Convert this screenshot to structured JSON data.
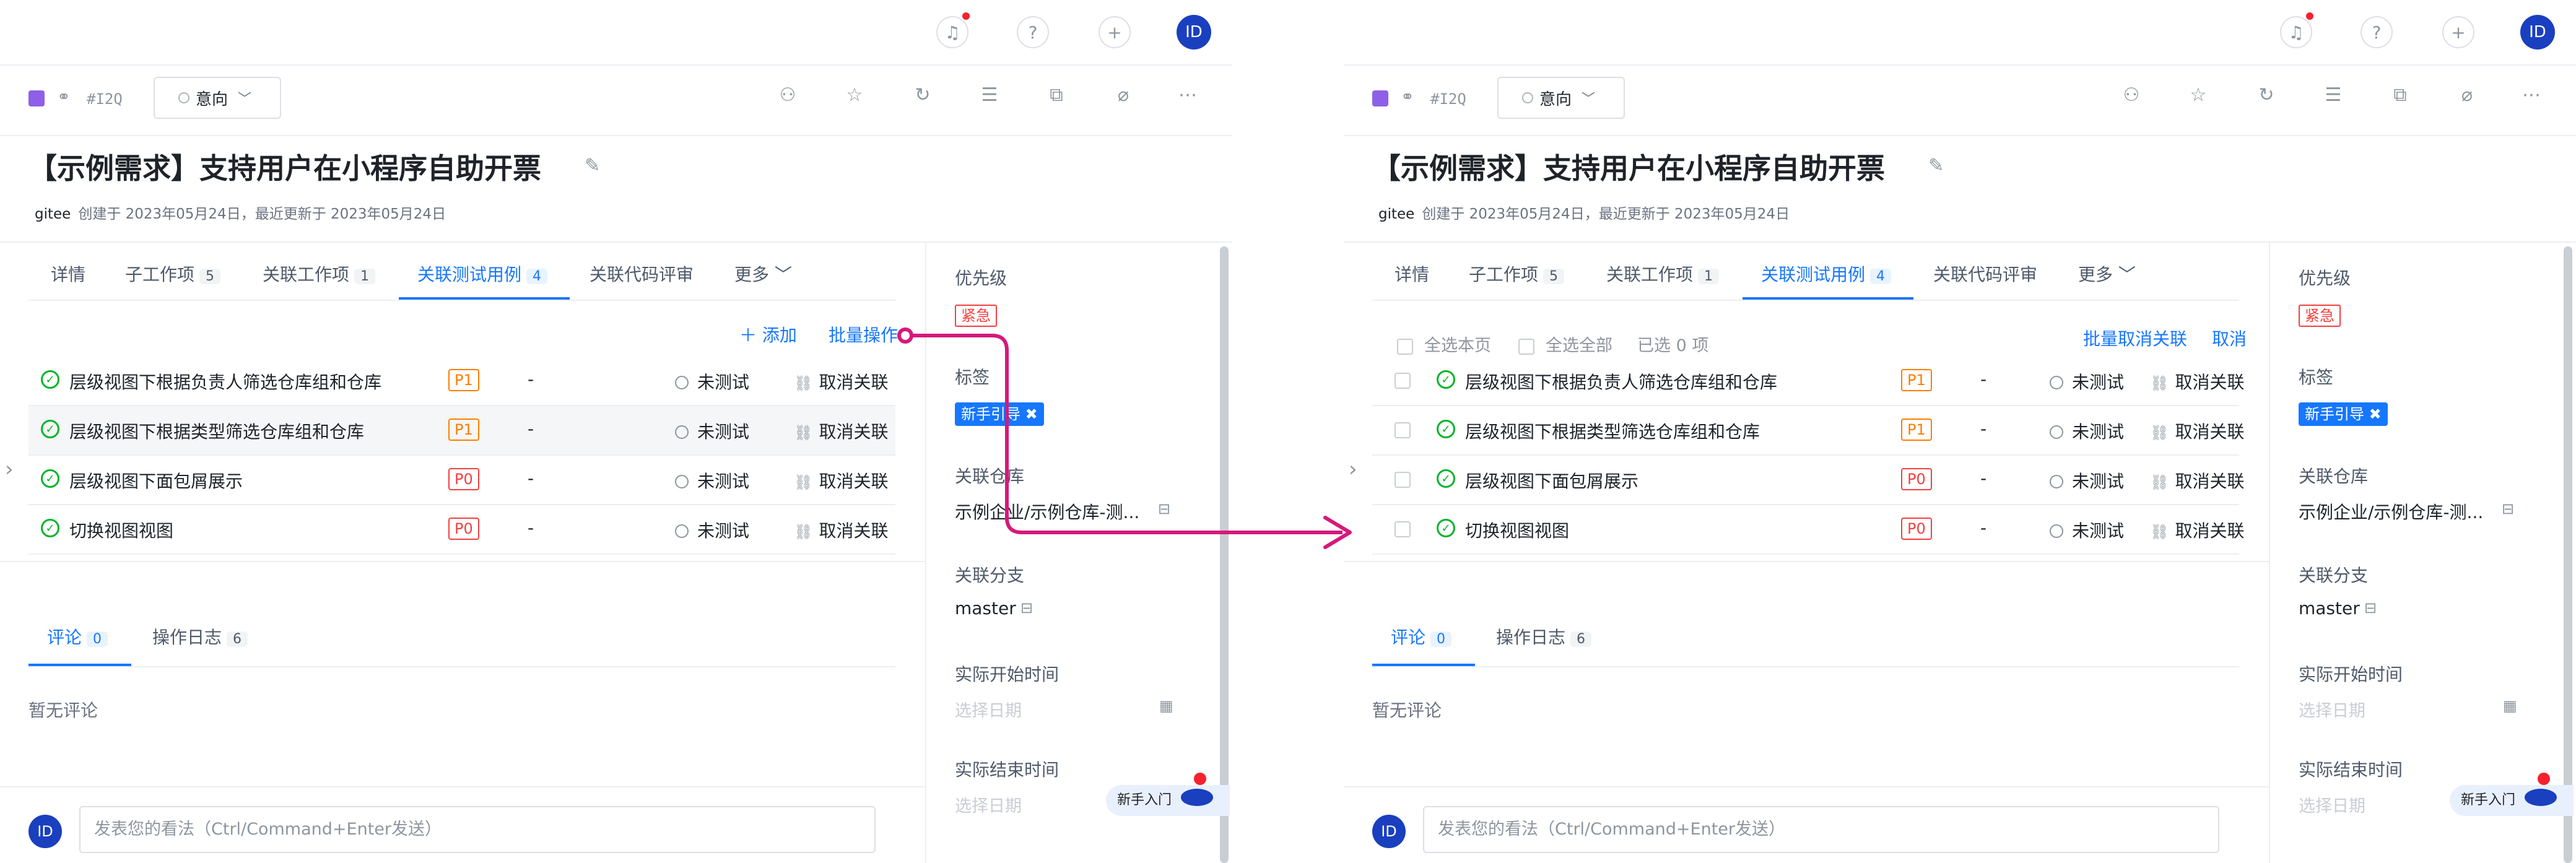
{
  "topbar": {
    "avatar": "ID"
  },
  "issue": {
    "id": "#I2Q",
    "status": "意向",
    "title": "【示例需求】支持用户在小程序自助开票",
    "author": "gitee",
    "meta": "创建于 2023年05月24日，最近更新于 2023年05月24日"
  },
  "tabs": [
    {
      "label": "详情",
      "count": ""
    },
    {
      "label": "子工作项",
      "count": "5"
    },
    {
      "label": "关联工作项",
      "count": "1"
    },
    {
      "label": "关联测试用例",
      "count": "4"
    },
    {
      "label": "关联代码评审",
      "count": ""
    },
    {
      "label": "更多",
      "count": ""
    }
  ],
  "left_actions": {
    "add": "添加",
    "batch": "批量操作"
  },
  "right_actions": {
    "select_page": "全选本页",
    "select_all": "全选全部",
    "selected": "已选 0 项",
    "batch_unlink": "批量取消关联",
    "cancel": "取消"
  },
  "cases": [
    {
      "name": "层级视图下根据负责人筛选仓库组和仓库",
      "priority": "P1",
      "dash": "-",
      "status": "未测试",
      "action": "取消关联"
    },
    {
      "name": "层级视图下根据类型筛选仓库组和仓库",
      "priority": "P1",
      "dash": "-",
      "status": "未测试",
      "action": "取消关联"
    },
    {
      "name": "层级视图下面包屑展示",
      "priority": "P0",
      "dash": "-",
      "status": "未测试",
      "action": "取消关联"
    },
    {
      "name": "切换视图视图",
      "priority": "P0",
      "dash": "-",
      "status": "未测试",
      "action": "取消关联"
    }
  ],
  "comments": {
    "tabs": [
      {
        "label": "评论",
        "count": "0"
      },
      {
        "label": "操作日志",
        "count": "6"
      }
    ],
    "empty": "暂无评论",
    "placeholder": "发表您的看法（Ctrl/Command+Enter发送）",
    "avatar": "ID"
  },
  "sidebar": {
    "priority_label": "优先级",
    "priority_value": "紧急",
    "tags_label": "标签",
    "tag": "新手引导",
    "repo_label": "关联仓库",
    "repo_value": "示例企业/示例仓库-测...",
    "branch_label": "关联分支",
    "branch_value": "master",
    "start_label": "实际开始时间",
    "start_placeholder": "选择日期",
    "end_label": "实际结束时间",
    "end_placeholder": "选择日期"
  },
  "newbie": "新手入门",
  "colors": {
    "accent": "#1677ff",
    "p1": "#ff7d00",
    "p0": "#f53f3f",
    "annotation": "#d6197a"
  }
}
